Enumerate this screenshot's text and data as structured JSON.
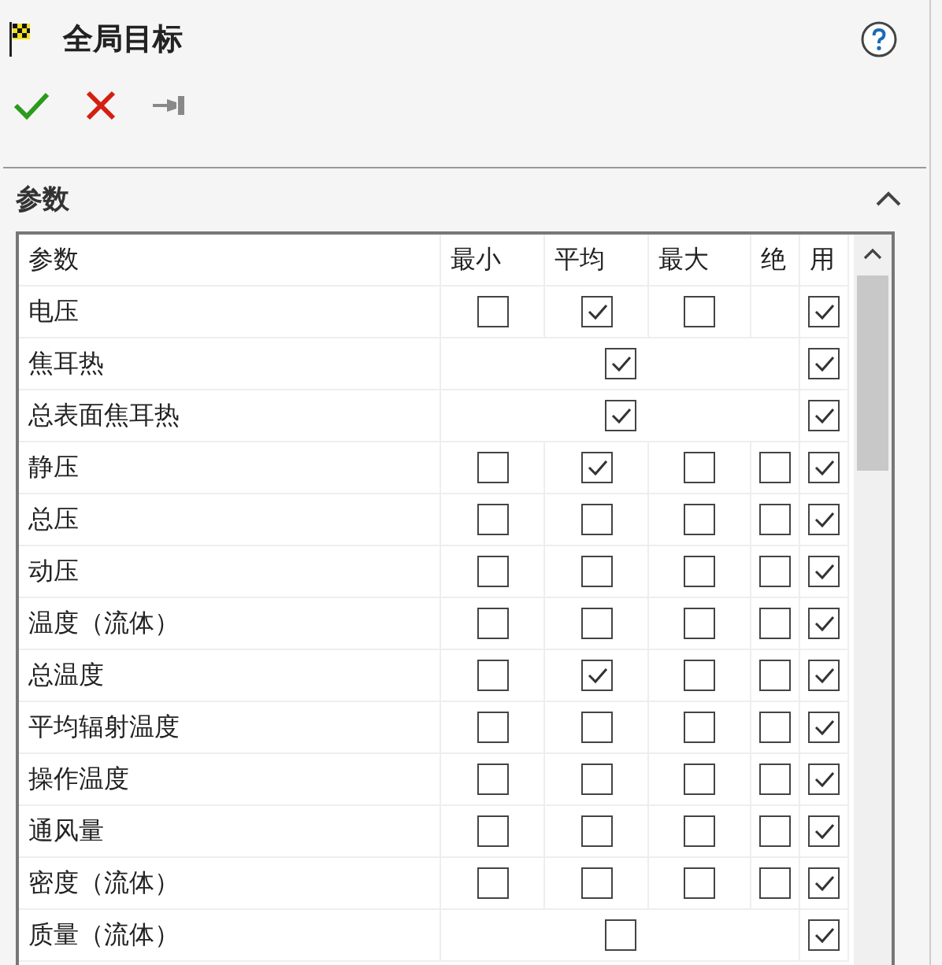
{
  "header": {
    "title": "全局目标"
  },
  "section": {
    "title": "参数",
    "expanded": true
  },
  "table": {
    "columns": [
      "参数",
      "最小",
      "平均",
      "最大",
      "绝",
      "用"
    ],
    "rows": [
      {
        "name": "电压",
        "kind": "three",
        "min": false,
        "avg": true,
        "max": false,
        "use": true
      },
      {
        "name": "焦耳热",
        "kind": "single",
        "avg": true,
        "use": true
      },
      {
        "name": "总表面焦耳热",
        "kind": "single",
        "avg": true,
        "use": true
      },
      {
        "name": "静压",
        "kind": "four",
        "min": false,
        "avg": true,
        "max": false,
        "abs": false,
        "use": true
      },
      {
        "name": "总压",
        "kind": "four",
        "min": false,
        "avg": false,
        "max": false,
        "abs": false,
        "use": true
      },
      {
        "name": "动压",
        "kind": "four",
        "min": false,
        "avg": false,
        "max": false,
        "abs": false,
        "use": true
      },
      {
        "name": "温度（流体）",
        "kind": "four",
        "min": false,
        "avg": false,
        "max": false,
        "abs": false,
        "use": true
      },
      {
        "name": "总温度",
        "kind": "four",
        "min": false,
        "avg": true,
        "max": false,
        "abs": false,
        "use": true
      },
      {
        "name": "平均辐射温度",
        "kind": "four",
        "min": false,
        "avg": false,
        "max": false,
        "abs": false,
        "use": true
      },
      {
        "name": "操作温度",
        "kind": "four",
        "min": false,
        "avg": false,
        "max": false,
        "abs": false,
        "use": true
      },
      {
        "name": "通风量",
        "kind": "four",
        "min": false,
        "avg": false,
        "max": false,
        "abs": false,
        "use": true
      },
      {
        "name": "密度（流体）",
        "kind": "four",
        "min": false,
        "avg": false,
        "max": false,
        "abs": false,
        "use": true
      },
      {
        "name": "质量（流体）",
        "kind": "single",
        "avg": false,
        "use": true
      }
    ]
  }
}
